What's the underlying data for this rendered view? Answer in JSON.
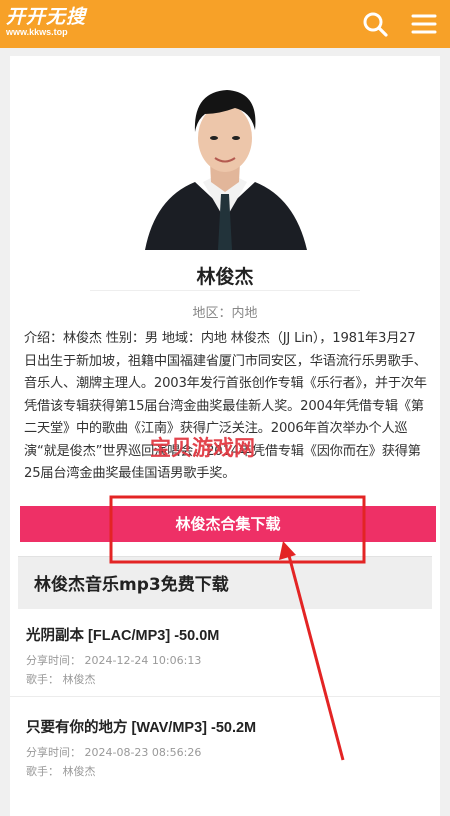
{
  "header": {
    "logo_text": "开开无搜",
    "logo_url": "www.kkws.top",
    "search_icon": "search-icon",
    "menu_icon": "menu-icon",
    "accent": "#f7a128"
  },
  "artist": {
    "name": "林俊杰",
    "region": "地区：内地",
    "intro": "介绍：林俊杰 性别：男 地域：内地 林俊杰（JJ Lin），1981年3月27日出生于新加坡，祖籍中国福建省厦门市同安区，华语流行乐男歌手、音乐人、潮牌主理人。2003年发行首张创作专辑《乐行者》，并于次年凭借该专辑获得第15届台湾金曲奖最佳新人奖。2004年凭借专辑《第二天堂》中的歌曲《江南》获得广泛关注。2006年首次举办个人巡演“就是俊杰”世界巡回演唱会。2014年凭借专辑《因你而在》获得第25届台湾金曲奖最佳国语男歌手奖。",
    "download_button": "林俊杰合集下载",
    "button_color": "#ee3066"
  },
  "section": {
    "title": "林俊杰音乐mp3免费下载"
  },
  "songs": [
    {
      "title": "光阴副本 [FLAC/MP3] -50.0M",
      "share_time": "分享时间：  2024-12-24 10:06:13",
      "singer": "歌手：  林俊杰"
    },
    {
      "title": "只要有你的地方 [WAV/MP3] -50.2M",
      "share_time": "分享时间：  2024-08-23 08:56:26",
      "singer": "歌手：  林俊杰"
    }
  ],
  "watermark": "宝贝游戏网"
}
